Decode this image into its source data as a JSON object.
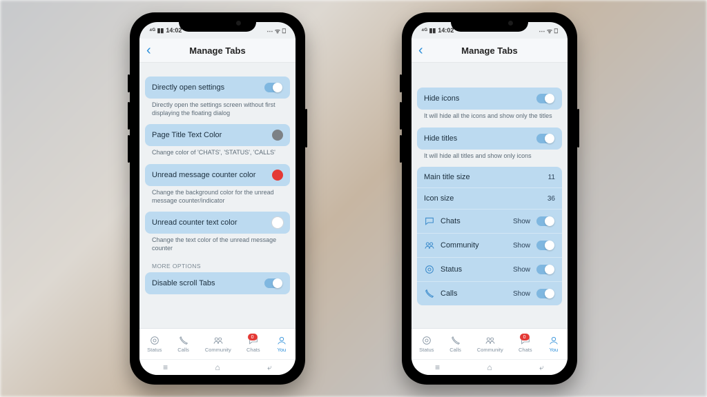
{
  "statusbar": {
    "time": "14:02"
  },
  "header": {
    "title": "Manage Tabs"
  },
  "colors": {
    "accent": "#2a8ed9",
    "card_bg": "#bcdaf0",
    "counter_red": "#e43935",
    "grey_swatch": "#7d8185",
    "white_swatch": "#ffffff"
  },
  "phone1": {
    "items": [
      {
        "title": "Directly open settings",
        "desc": "Directly open the settings screen without first displaying the floating dialog",
        "control": "toggle",
        "value": true
      },
      {
        "title": "Page Title Text Color",
        "desc": "Change color of 'CHATS', 'STATUS', 'CALLS'",
        "control": "swatch",
        "swatch": "#7d8185"
      },
      {
        "title": "Unread message counter color",
        "desc": "Change the background color for the unread message counter/indicator",
        "control": "swatch",
        "swatch": "#e43935"
      },
      {
        "title": "Unread counter text color",
        "desc": "Change the text color of the unread message counter",
        "control": "swatch",
        "swatch": "#ffffff"
      }
    ],
    "more_options_label": "MORE OPTIONS",
    "disable_scroll": {
      "title": "Disable scroll Tabs",
      "value": true
    }
  },
  "phone2": {
    "hide_icons": {
      "title": "Hide icons",
      "desc": "It will hide all the icons and show only the titles",
      "value": true
    },
    "hide_titles": {
      "title": "Hide titles",
      "desc": "It will hide all titles and show only icons",
      "value": true
    },
    "sizes": [
      {
        "label": "Main title size",
        "value": "11"
      },
      {
        "label": "Icon size",
        "value": "36"
      }
    ],
    "tabs": [
      {
        "icon": "chat",
        "label": "Chats",
        "state": "Show",
        "toggle": true
      },
      {
        "icon": "community",
        "label": "Community",
        "state": "Show",
        "toggle": true
      },
      {
        "icon": "status",
        "label": "Status",
        "state": "Show",
        "toggle": true
      },
      {
        "icon": "calls",
        "label": "Calls",
        "state": "Show",
        "toggle": true
      }
    ]
  },
  "nav": {
    "items": [
      {
        "label": "Status",
        "icon": "status"
      },
      {
        "label": "Calls",
        "icon": "calls"
      },
      {
        "label": "Community",
        "icon": "community"
      },
      {
        "label": "Chats",
        "icon": "chat",
        "badge": "0"
      },
      {
        "label": "You",
        "icon": "you",
        "active": true
      }
    ]
  }
}
